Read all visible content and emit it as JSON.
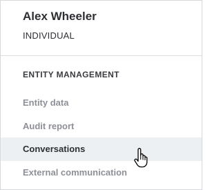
{
  "user": {
    "name": "Alex Wheeler",
    "role": "INDIVIDUAL"
  },
  "section": {
    "title": "ENTITY MANAGEMENT"
  },
  "nav": {
    "items": [
      {
        "label": "Entity data",
        "active": false
      },
      {
        "label": "Audit report",
        "active": false
      },
      {
        "label": "Conversations",
        "active": true
      },
      {
        "label": "External communication",
        "active": false
      }
    ]
  },
  "cursor": {
    "icon": "hand-pointer-icon"
  }
}
